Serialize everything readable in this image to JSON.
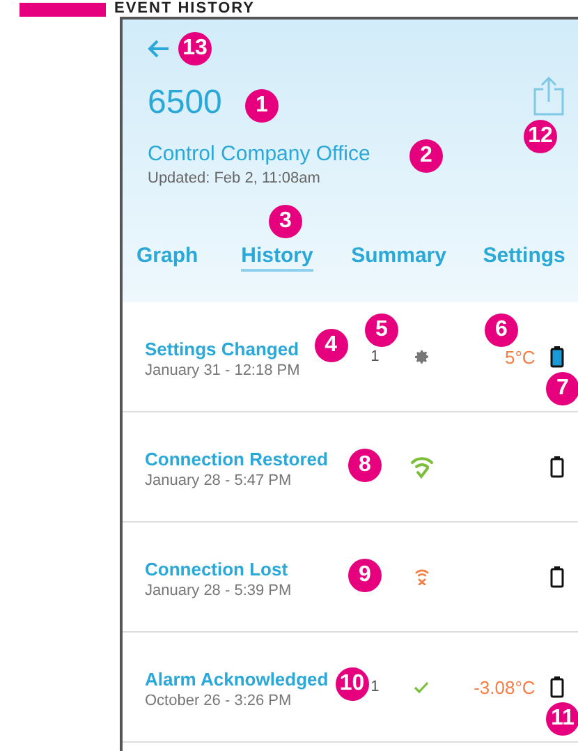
{
  "page_heading": {
    "title": "EVENT HISTORY"
  },
  "header": {
    "back_callout": "13",
    "device": "6500",
    "device_callout": "1",
    "location": "Control Company Office",
    "location_callout": "2",
    "updated": "Updated: Feb 2, 11:08am",
    "share_callout": "12"
  },
  "tabs": [
    {
      "label": "Graph",
      "selected": false
    },
    {
      "label": "History",
      "selected": true,
      "callout": "3"
    },
    {
      "label": "Summary",
      "selected": false
    },
    {
      "label": "Settings",
      "selected": false
    }
  ],
  "events": [
    {
      "title": "Settings Changed",
      "time": "January 31 - 12:18 PM",
      "title_callout": "4",
      "count": "1",
      "count_callout": "5",
      "kind": "gear",
      "temperature": "5°C",
      "temp_callout": "6",
      "battery_full": true,
      "battery_callout": "7"
    },
    {
      "title": "Connection Restored",
      "time": "January 28 - 5:47 PM",
      "count_callout": "8",
      "kind": "wifi-ok",
      "battery_full": false
    },
    {
      "title": "Connection Lost",
      "time": "January 28 - 5:39 PM",
      "count_callout": "9",
      "kind": "wifi-lost",
      "battery_full": false
    },
    {
      "title": "Alarm Acknowledged",
      "time": "October 26 - 3:26 PM",
      "title_callout": "10",
      "count": "1",
      "kind": "check",
      "temperature": "-3.08°C",
      "battery_full": false,
      "battery_callout": "11"
    }
  ]
}
